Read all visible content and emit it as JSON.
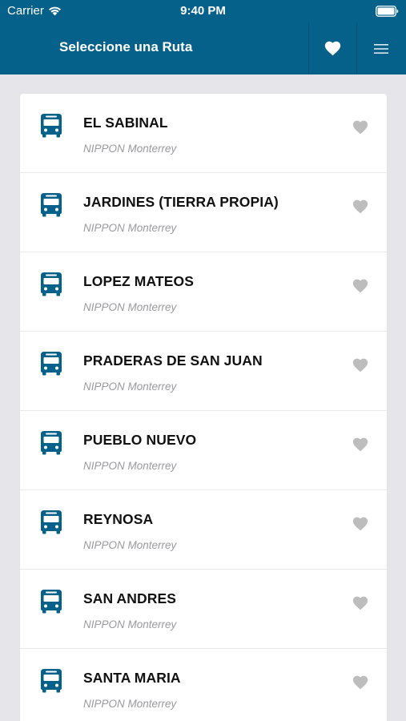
{
  "status_bar": {
    "carrier": "Carrier",
    "time": "9:40 PM"
  },
  "navbar": {
    "title": "Seleccione una Ruta",
    "favorites_icon": "heart-icon",
    "menu_icon": "hamburger-menu-icon"
  },
  "colors": {
    "primary": "#06618a",
    "background": "#e6e6ea",
    "heart_inactive": "#bdbdbd",
    "subtitle": "#9a9a9e"
  },
  "routes": [
    {
      "name": "EL SABINAL",
      "company": "NIPPON Monterrey"
    },
    {
      "name": "JARDINES (TIERRA PROPIA)",
      "company": "NIPPON Monterrey"
    },
    {
      "name": "LOPEZ MATEOS",
      "company": "NIPPON Monterrey"
    },
    {
      "name": "PRADERAS DE SAN JUAN",
      "company": "NIPPON Monterrey"
    },
    {
      "name": "PUEBLO NUEVO",
      "company": "NIPPON Monterrey"
    },
    {
      "name": "REYNOSA",
      "company": "NIPPON Monterrey"
    },
    {
      "name": "SAN ANDRES",
      "company": "NIPPON Monterrey"
    },
    {
      "name": "SANTA MARIA",
      "company": "NIPPON Monterrey"
    }
  ]
}
